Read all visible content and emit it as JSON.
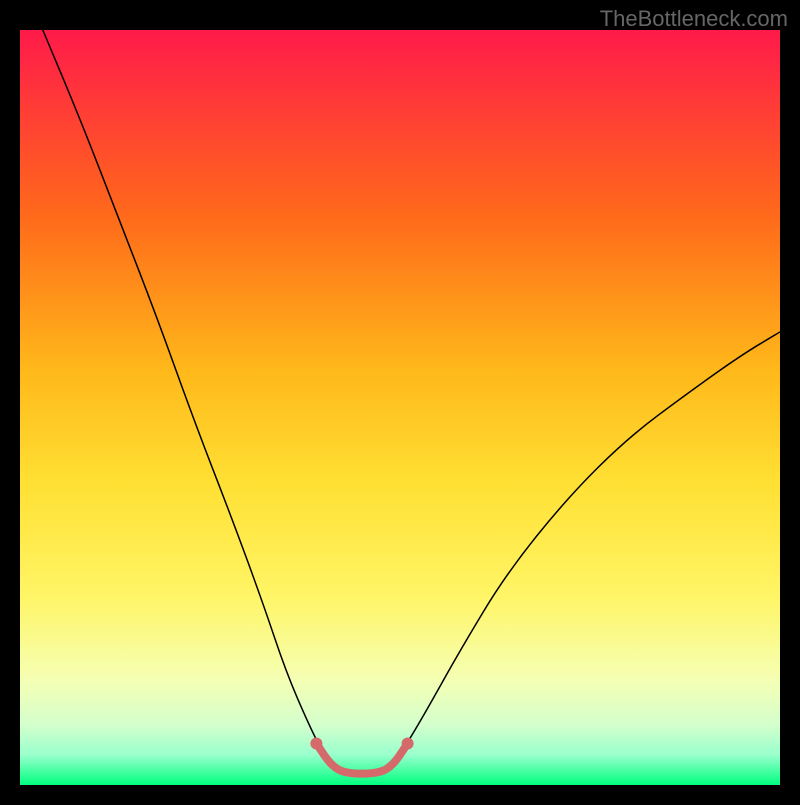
{
  "watermark": "TheBottleneck.com",
  "chart_data": {
    "type": "line",
    "title": "",
    "xlabel": "",
    "ylabel": "",
    "xlim": [
      0,
      100
    ],
    "ylim": [
      0,
      100
    ],
    "gradient_colors": {
      "top": "#ff1a4a",
      "upper_mid": "#ff8c1a",
      "mid": "#ffd633",
      "lower_mid": "#f5ff66",
      "bottom_band": "#e6ffb3",
      "bottom": "#00ff7f"
    },
    "series": [
      {
        "name": "left_curve",
        "color": "#000000",
        "stroke_width": 1.5,
        "points": [
          {
            "x": 3,
            "y": 100
          },
          {
            "x": 8,
            "y": 88
          },
          {
            "x": 13,
            "y": 75
          },
          {
            "x": 18,
            "y": 62
          },
          {
            "x": 23,
            "y": 48
          },
          {
            "x": 28,
            "y": 35
          },
          {
            "x": 32,
            "y": 24
          },
          {
            "x": 35,
            "y": 15
          },
          {
            "x": 38,
            "y": 8
          },
          {
            "x": 40,
            "y": 4
          }
        ]
      },
      {
        "name": "right_curve",
        "color": "#000000",
        "stroke_width": 1.5,
        "points": [
          {
            "x": 50,
            "y": 4
          },
          {
            "x": 53,
            "y": 9
          },
          {
            "x": 58,
            "y": 18
          },
          {
            "x": 64,
            "y": 28
          },
          {
            "x": 72,
            "y": 38
          },
          {
            "x": 80,
            "y": 46
          },
          {
            "x": 88,
            "y": 52
          },
          {
            "x": 95,
            "y": 57
          },
          {
            "x": 100,
            "y": 60
          }
        ]
      },
      {
        "name": "bottom_valley",
        "color": "#d46a6a",
        "stroke_width": 8,
        "points": [
          {
            "x": 39,
            "y": 5.5
          },
          {
            "x": 41,
            "y": 2.5
          },
          {
            "x": 43,
            "y": 1.5
          },
          {
            "x": 47,
            "y": 1.5
          },
          {
            "x": 49,
            "y": 2.5
          },
          {
            "x": 51,
            "y": 5.5
          }
        ]
      }
    ]
  }
}
